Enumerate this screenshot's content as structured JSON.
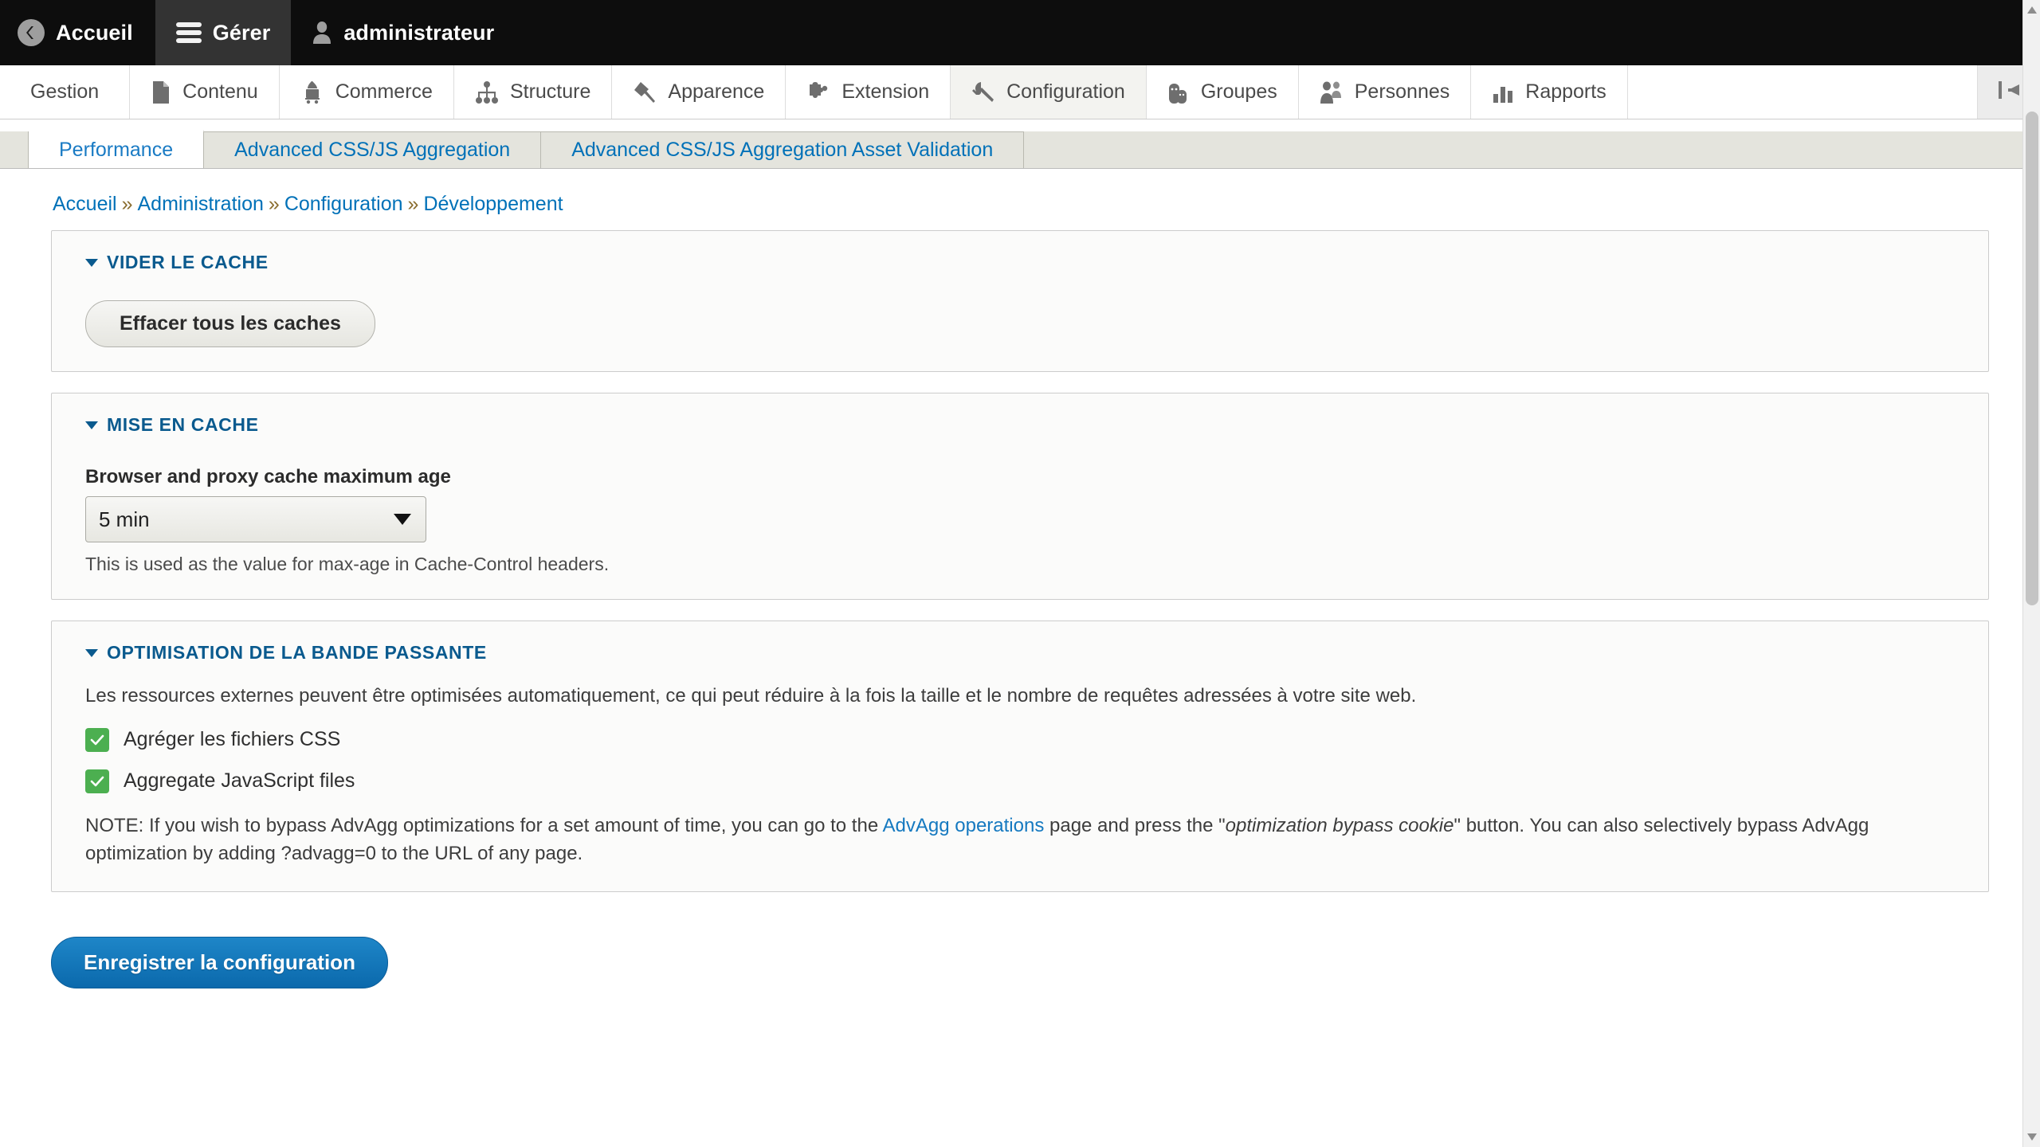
{
  "toolbar": {
    "home_label": "Accueil",
    "manage_label": "Gérer",
    "user_label": "administrateur",
    "home_icon": "back-circle-icon",
    "manage_icon": "hamburger-icon",
    "user_icon": "person-icon"
  },
  "menu": {
    "items": [
      {
        "label": "Gestion",
        "icon": "none",
        "active": false
      },
      {
        "label": "Contenu",
        "icon": "document-icon",
        "active": false
      },
      {
        "label": "Commerce",
        "icon": "shopping-cart-icon",
        "active": false
      },
      {
        "label": "Structure",
        "icon": "sitemap-icon",
        "active": false
      },
      {
        "label": "Apparence",
        "icon": "paintbrush-icon",
        "active": false
      },
      {
        "label": "Extension",
        "icon": "puzzle-piece-icon",
        "active": false
      },
      {
        "label": "Configuration",
        "icon": "wrench-icon",
        "active": true
      },
      {
        "label": "Groupes",
        "icon": "groups-icon",
        "active": false
      },
      {
        "label": "Personnes",
        "icon": "people-icon",
        "active": false
      },
      {
        "label": "Rapports",
        "icon": "bar-chart-icon",
        "active": false
      }
    ],
    "collapse_icon": "collapse-left-icon"
  },
  "tabs": [
    {
      "label": "Performance",
      "active": true
    },
    {
      "label": "Advanced CSS/JS Aggregation",
      "active": false
    },
    {
      "label": "Advanced CSS/JS Aggregation Asset Validation",
      "active": false
    }
  ],
  "breadcrumb": {
    "items": [
      "Accueil",
      "Administration",
      "Configuration",
      "Développement"
    ],
    "separator": "»"
  },
  "sections": {
    "clear_cache": {
      "legend": "VIDER LE CACHE",
      "button_label": "Effacer tous les caches"
    },
    "caching": {
      "legend": "MISE EN CACHE",
      "field_label": "Browser and proxy cache maximum age",
      "select_value": "5 min",
      "description": "This is used as the value for max-age in Cache-Control headers."
    },
    "bandwidth": {
      "legend": "OPTIMISATION DE LA BANDE PASSANTE",
      "intro": "Les ressources externes peuvent être optimisées automatiquement, ce qui peut réduire à la fois la taille et le nombre de requêtes adressées à votre site web.",
      "checkbox_css_label": "Agréger les fichiers CSS",
      "checkbox_js_label": "Aggregate JavaScript files",
      "checkbox_css_checked": true,
      "checkbox_js_checked": true,
      "note_part1": "NOTE: If you wish to bypass AdvAgg optimizations for a set amount of time, you can go to the ",
      "note_link": "AdvAgg operations",
      "note_part2": " page and press the \"",
      "note_italic": "optimization bypass cookie",
      "note_part3": "\" button. You can also selectively bypass AdvAgg optimization by adding ?advagg=0 to the URL of any page."
    }
  },
  "actions": {
    "save_label": "Enregistrer la configuration"
  },
  "colors": {
    "toolbar_bg": "#0d0d0d",
    "link": "#0071b8",
    "legend": "#0a5a8e",
    "primary_button": "#1277bd",
    "checkbox_green": "#4caf50"
  }
}
